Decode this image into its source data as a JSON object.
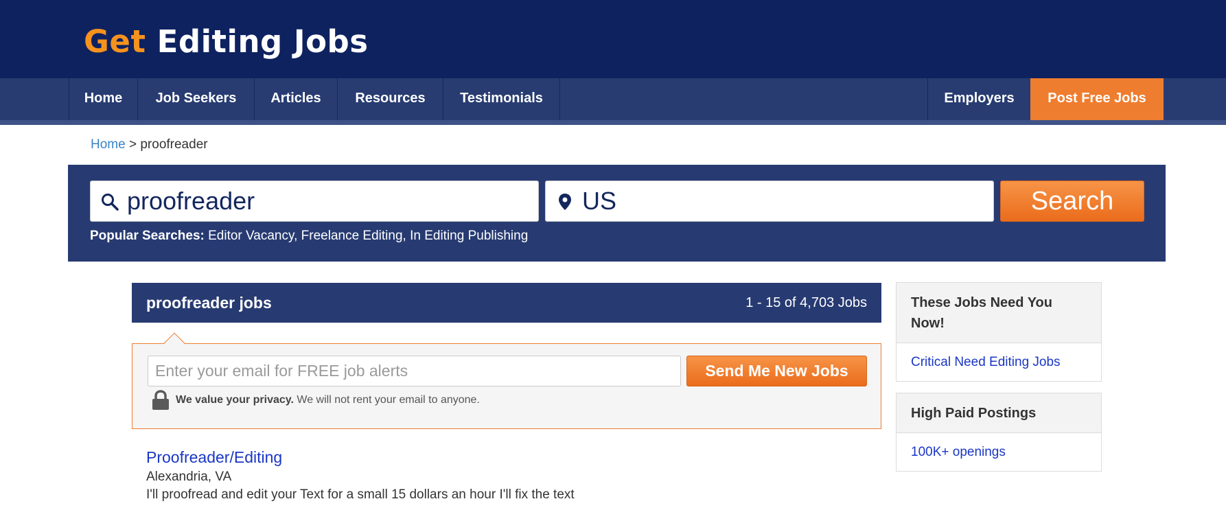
{
  "logo": {
    "get": "Get",
    "rest": "Editing Jobs"
  },
  "nav": {
    "home": "Home",
    "job_seekers": "Job Seekers",
    "articles": "Articles",
    "resources": "Resources",
    "testimonials": "Testimonials",
    "employers": "Employers",
    "post_free_jobs": "Post Free Jobs"
  },
  "breadcrumb": {
    "home": "Home",
    "separator": ">",
    "current": "proofreader"
  },
  "search": {
    "keyword": "proofreader",
    "location": "US",
    "button": "Search",
    "popular_label": "Popular Searches:",
    "popular_items": [
      "Editor Vacancy",
      "Freelance Editing",
      "In Editing Publishing"
    ]
  },
  "results": {
    "title": "proofreader jobs",
    "count": "1 - 15 of 4,703 Jobs"
  },
  "alert": {
    "placeholder": "Enter your email for FREE job alerts",
    "button": "Send Me New Jobs",
    "privacy_strong": "We value your privacy.",
    "privacy_rest": "We will not rent your email to anyone."
  },
  "job": {
    "title": "Proofreader/Editing",
    "location": "Alexandria, VA",
    "snippet": "I'll proofread and edit your Text for a small 15 dollars an hour I'll fix the text"
  },
  "sidebar": {
    "card1": {
      "heading": "These Jobs Need You Now!",
      "link": "Critical Need Editing Jobs"
    },
    "card2": {
      "heading": "High Paid Postings",
      "link": "100K+ openings"
    }
  },
  "colors": {
    "navy": "#0e2260",
    "nav_blue": "#283c72",
    "orange": "#ef7d2f",
    "logo_orange": "#f6921e",
    "link_blue": "#1a36c4"
  },
  "icons": {
    "search": "search-icon",
    "location": "map-pin-icon",
    "privacy": "lock-icon"
  }
}
